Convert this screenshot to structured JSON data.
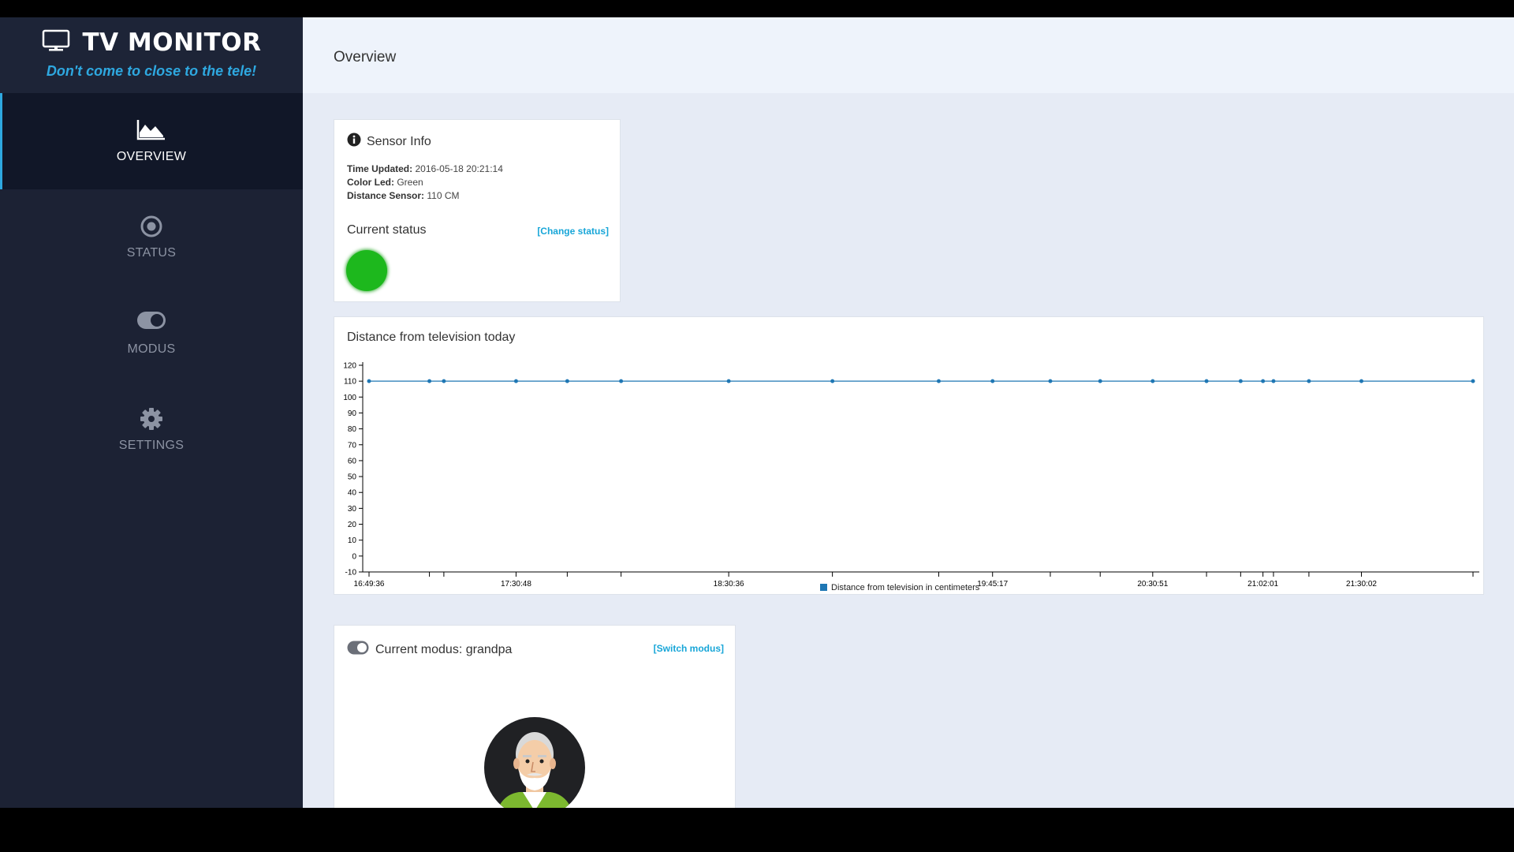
{
  "brand": {
    "title": "TV MONITOR",
    "tagline": "Don't come to close to the tele!"
  },
  "sidebar": {
    "items": [
      {
        "label": "OVERVIEW",
        "icon": "area-chart-icon",
        "active": true
      },
      {
        "label": "STATUS",
        "icon": "radio-dot-icon",
        "active": false
      },
      {
        "label": "MODUS",
        "icon": "toggle-icon",
        "active": false
      },
      {
        "label": "SETTINGS",
        "icon": "gear-icon",
        "active": false
      }
    ]
  },
  "header": {
    "title": "Overview"
  },
  "sensor": {
    "title": "Sensor Info",
    "time_label": "Time Updated:",
    "time_value": "2016-05-18 20:21:14",
    "color_label": "Color Led:",
    "color_value": "Green",
    "distance_label": "Distance Sensor:",
    "distance_value": "110 CM",
    "status_title": "Current status",
    "change_link": "[Change status]",
    "status_color": "#1db81d"
  },
  "distance_chart": {
    "title": "Distance from television today"
  },
  "chart_data": {
    "type": "line",
    "x": [
      0,
      4.6,
      5.7,
      11.2,
      15.1,
      19.2,
      27.4,
      35.3,
      43.4,
      47.5,
      51.9,
      55.7,
      59.7,
      63.8,
      66.4,
      68.1,
      68.9,
      71.6,
      75.6,
      84.1
    ],
    "xticklabels": [
      "16:49:36",
      "17:30:48",
      "18:30:36",
      "19:45:17",
      "20:30:51",
      "21:02:01",
      "21:30:02"
    ],
    "series": [
      {
        "name": "Distance from television in centimeters",
        "values": [
          110,
          110,
          110,
          110,
          110,
          110,
          110,
          110,
          110,
          110,
          110,
          110,
          110,
          110,
          110,
          110,
          110,
          110,
          110,
          110
        ]
      }
    ],
    "ylim": [
      -10,
      120
    ],
    "yticks": [
      -10,
      0,
      10,
      20,
      30,
      40,
      50,
      60,
      70,
      80,
      90,
      100,
      110,
      120
    ],
    "legend": "bottom-center",
    "color": "#1f77b4"
  },
  "modus": {
    "title": "Current modus: grandpa",
    "switch_link": "[Switch modus]"
  }
}
